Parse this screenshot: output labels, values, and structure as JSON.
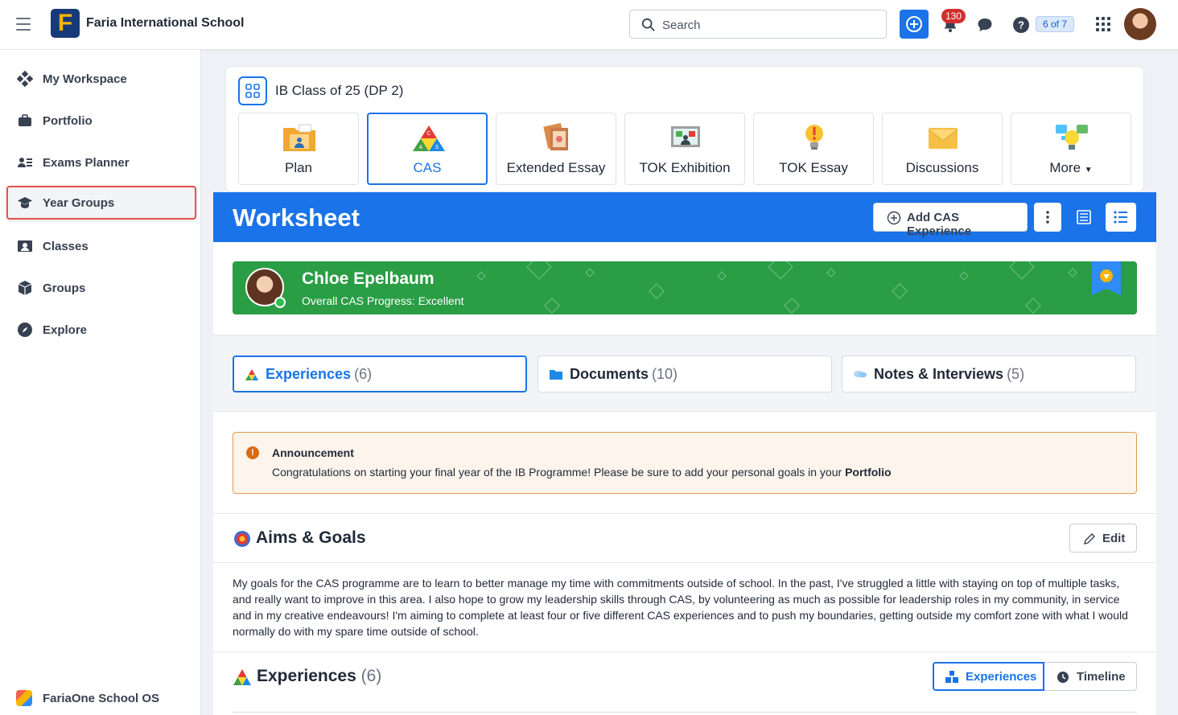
{
  "header": {
    "school_name": "Faria International School",
    "logo_letter": "F",
    "search_placeholder": "Search",
    "notification_count": "130",
    "help_counter": "6 of 7"
  },
  "sidebar": {
    "items": [
      {
        "label": "My Workspace",
        "icon": "workspace-icon"
      },
      {
        "label": "Portfolio",
        "icon": "briefcase-icon"
      },
      {
        "label": "Exams Planner",
        "icon": "exams-planner-icon"
      },
      {
        "label": "Year Groups",
        "icon": "graduation-cap-icon",
        "active": true
      },
      {
        "label": "Classes",
        "icon": "classes-icon"
      },
      {
        "label": "Groups",
        "icon": "cube-icon"
      },
      {
        "label": "Explore",
        "icon": "compass-icon"
      }
    ],
    "footer_label": "FariaOne School OS"
  },
  "class_card": {
    "title": "IB Class of 25 (DP 2)",
    "tiles": [
      {
        "label": "Plan",
        "icon": "plan-folder-icon"
      },
      {
        "label": "CAS",
        "icon": "cas-triangle-icon",
        "selected": true
      },
      {
        "label": "Extended Essay",
        "icon": "extended-essay-icon"
      },
      {
        "label": "TOK Exhibition",
        "icon": "tok-exhibition-icon"
      },
      {
        "label": "TOK Essay",
        "icon": "tok-essay-icon"
      },
      {
        "label": "Discussions",
        "icon": "envelope-icon"
      },
      {
        "label": "More",
        "icon": "more-bulb-icon"
      }
    ]
  },
  "worksheet": {
    "title": "Worksheet",
    "add_cas_label": "Add CAS Experience"
  },
  "student": {
    "name": "Chloe Epelbaum",
    "progress": "Overall CAS Progress: Excellent"
  },
  "tabs": [
    {
      "label": "Experiences",
      "count": "(6)",
      "icon": "cas-triangle-icon",
      "active": true
    },
    {
      "label": "Documents",
      "count": "(10)",
      "icon": "folder-icon"
    },
    {
      "label": "Notes & Interviews",
      "count": "(5)",
      "icon": "notes-icon"
    }
  ],
  "announcement": {
    "title": "Announcement",
    "text": "Congratulations on starting your final year of the IB Programme! Please be sure to add your personal goals in your ",
    "bold_text": "Portfolio"
  },
  "aims": {
    "title": "Aims & Goals",
    "edit_label": "Edit",
    "text": "My goals for the CAS programme are to learn to better manage my time with commitments outside of school. In the past, I've struggled a little with staying on top of multiple tasks, and really want to improve in this area. I also hope to grow my leadership skills through CAS, by volunteering as much as possible for leadership roles in my community, in service and in my creative endeavours! I'm aiming to complete at least four or five different CAS experiences and to push my boundaries, getting outside my comfort zone with what I would normally do with my spare time outside of school."
  },
  "experiences": {
    "title": "Experiences",
    "count": "(6)",
    "toggle_experiences": "Experiences",
    "toggle_timeline": "Timeline"
  },
  "colors": {
    "primary": "#1a73e8",
    "banner_green": "#2a9d45",
    "announcement_border": "#e39a4e",
    "highlight_red": "#e4534a"
  }
}
